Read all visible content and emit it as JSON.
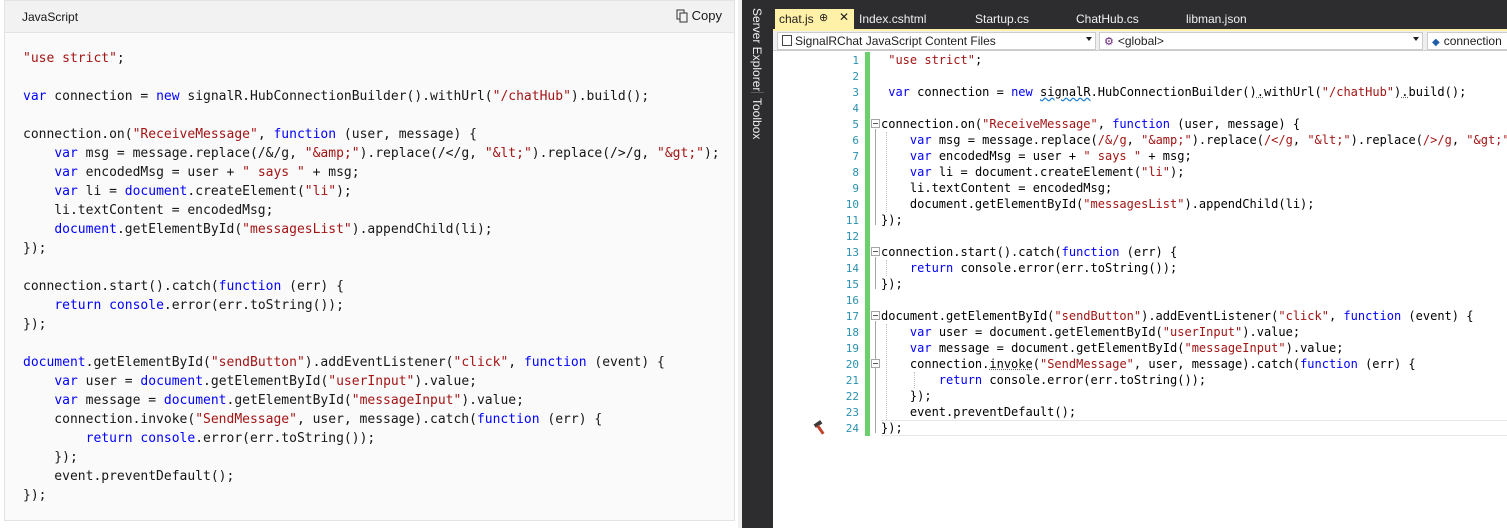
{
  "doc": {
    "language": "JavaScript",
    "copy_label": "Copy",
    "code_lines": [
      [
        {
          "t": "\"use strict\"",
          "c": "s"
        },
        {
          "t": ";"
        }
      ],
      [],
      [
        {
          "t": "var",
          "c": "k"
        },
        {
          "t": " connection = "
        },
        {
          "t": "new",
          "c": "k"
        },
        {
          "t": " signalR.HubConnectionBuilder().withUrl("
        },
        {
          "t": "\"/chatHub\"",
          "c": "s"
        },
        {
          "t": ").build();"
        }
      ],
      [],
      [
        {
          "t": "connection.on("
        },
        {
          "t": "\"ReceiveMessage\"",
          "c": "s"
        },
        {
          "t": ", "
        },
        {
          "t": "function",
          "c": "k"
        },
        {
          "t": " (user, message) {"
        }
      ],
      [
        {
          "t": "    "
        },
        {
          "t": "var",
          "c": "k"
        },
        {
          "t": " msg = message.replace(/&/g, "
        },
        {
          "t": "\"&amp;\"",
          "c": "s"
        },
        {
          "t": ").replace(/</g, "
        },
        {
          "t": "\"&lt;\"",
          "c": "s"
        },
        {
          "t": ").replace(/>/g, "
        },
        {
          "t": "\"&gt;\"",
          "c": "s"
        },
        {
          "t": ");"
        }
      ],
      [
        {
          "t": "    "
        },
        {
          "t": "var",
          "c": "k"
        },
        {
          "t": " encodedMsg = user + "
        },
        {
          "t": "\" says \"",
          "c": "s"
        },
        {
          "t": " + msg;"
        }
      ],
      [
        {
          "t": "    "
        },
        {
          "t": "var",
          "c": "k"
        },
        {
          "t": " li = "
        },
        {
          "t": "document",
          "c": "k"
        },
        {
          "t": ".createElement("
        },
        {
          "t": "\"li\"",
          "c": "s"
        },
        {
          "t": ");"
        }
      ],
      [
        {
          "t": "    li.textContent = encodedMsg;"
        }
      ],
      [
        {
          "t": "    "
        },
        {
          "t": "document",
          "c": "k"
        },
        {
          "t": ".getElementById("
        },
        {
          "t": "\"messagesList\"",
          "c": "s"
        },
        {
          "t": ").appendChild(li);"
        }
      ],
      [
        {
          "t": "});"
        }
      ],
      [],
      [
        {
          "t": "connection.start().catch("
        },
        {
          "t": "function",
          "c": "k"
        },
        {
          "t": " (err) {"
        }
      ],
      [
        {
          "t": "    "
        },
        {
          "t": "return",
          "c": "k"
        },
        {
          "t": " "
        },
        {
          "t": "console",
          "c": "k"
        },
        {
          "t": ".error(err.toString());"
        }
      ],
      [
        {
          "t": "});"
        }
      ],
      [],
      [
        {
          "t": "document",
          "c": "k"
        },
        {
          "t": ".getElementById("
        },
        {
          "t": "\"sendButton\"",
          "c": "s"
        },
        {
          "t": ").addEventListener("
        },
        {
          "t": "\"click\"",
          "c": "s"
        },
        {
          "t": ", "
        },
        {
          "t": "function",
          "c": "k"
        },
        {
          "t": " (event) {"
        }
      ],
      [
        {
          "t": "    "
        },
        {
          "t": "var",
          "c": "k"
        },
        {
          "t": " user = "
        },
        {
          "t": "document",
          "c": "k"
        },
        {
          "t": ".getElementById("
        },
        {
          "t": "\"userInput\"",
          "c": "s"
        },
        {
          "t": ").value;"
        }
      ],
      [
        {
          "t": "    "
        },
        {
          "t": "var",
          "c": "k"
        },
        {
          "t": " message = "
        },
        {
          "t": "document",
          "c": "k"
        },
        {
          "t": ".getElementById("
        },
        {
          "t": "\"messageInput\"",
          "c": "s"
        },
        {
          "t": ").value;"
        }
      ],
      [
        {
          "t": "    connection.invoke("
        },
        {
          "t": "\"SendMessage\"",
          "c": "s"
        },
        {
          "t": ", user, message).catch("
        },
        {
          "t": "function",
          "c": "k"
        },
        {
          "t": " (err) {"
        }
      ],
      [
        {
          "t": "        "
        },
        {
          "t": "return",
          "c": "k"
        },
        {
          "t": " "
        },
        {
          "t": "console",
          "c": "k"
        },
        {
          "t": ".error(err.toString());"
        }
      ],
      [
        {
          "t": "    });"
        }
      ],
      [
        {
          "t": "    event.preventDefault();"
        }
      ],
      [
        {
          "t": "});"
        }
      ]
    ]
  },
  "vs": {
    "side_tabs": [
      "Server Explorer",
      "Toolbox"
    ],
    "tabs": [
      "chat.js",
      "Index.cshtml",
      "Startup.cs",
      "ChatHub.cs",
      "libman.json"
    ],
    "active_tab_pin": "⊕",
    "active_tab_close": "✕",
    "nav": {
      "project": "SignalRChat JavaScript Content Files",
      "scope": "<global>",
      "member": "connection"
    },
    "line_numbers": [
      "1",
      "2",
      "3",
      "4",
      "5",
      "6",
      "7",
      "8",
      "9",
      "10",
      "11",
      "12",
      "13",
      "14",
      "15",
      "16",
      "17",
      "18",
      "19",
      "20",
      "21",
      "22",
      "23",
      "24"
    ],
    "code_lines": [
      [
        {
          "t": " "
        },
        {
          "t": "\"use strict\"",
          "c": "s"
        },
        {
          "t": ";"
        }
      ],
      [],
      [
        {
          "t": " "
        },
        {
          "t": "var",
          "c": "k"
        },
        {
          "t": " connection = "
        },
        {
          "t": "new",
          "c": "k"
        },
        {
          "t": " "
        },
        {
          "t": "signalR",
          "c": "q"
        },
        {
          "t": ".HubConnectionBuilder()"
        },
        {
          "t": ".",
          "c": "d"
        },
        {
          "t": "withUrl("
        },
        {
          "t": "\"/chatHub\"",
          "c": "s"
        },
        {
          "t": ")"
        },
        {
          "t": ".",
          "c": "d"
        },
        {
          "t": "build();"
        }
      ],
      [],
      [
        {
          "t": "connection.on("
        },
        {
          "t": "\"ReceiveMessage\"",
          "c": "s"
        },
        {
          "t": ", "
        },
        {
          "t": "function",
          "c": "k"
        },
        {
          "t": " (user, message) {"
        }
      ],
      [
        {
          "t": "    "
        },
        {
          "t": "var",
          "c": "k"
        },
        {
          "t": " msg = message.replace("
        },
        {
          "t": "/&/g",
          "c": "s"
        },
        {
          "t": ", "
        },
        {
          "t": "\"&amp;\"",
          "c": "s"
        },
        {
          "t": ").replace("
        },
        {
          "t": "/</g",
          "c": "s"
        },
        {
          "t": ", "
        },
        {
          "t": "\"&lt;\"",
          "c": "s"
        },
        {
          "t": ").replace("
        },
        {
          "t": "/>/g",
          "c": "s"
        },
        {
          "t": ", "
        },
        {
          "t": "\"&gt;\"",
          "c": "s"
        },
        {
          "t": ");"
        }
      ],
      [
        {
          "t": "    "
        },
        {
          "t": "var",
          "c": "k"
        },
        {
          "t": " encodedMsg = user + "
        },
        {
          "t": "\" says \"",
          "c": "s"
        },
        {
          "t": " + msg;"
        }
      ],
      [
        {
          "t": "    "
        },
        {
          "t": "var",
          "c": "k"
        },
        {
          "t": " li = document.createElement("
        },
        {
          "t": "\"li\"",
          "c": "s"
        },
        {
          "t": ");"
        }
      ],
      [
        {
          "t": "    li.textContent = encodedMsg;"
        }
      ],
      [
        {
          "t": "    document.getElementById("
        },
        {
          "t": "\"messagesList\"",
          "c": "s"
        },
        {
          "t": ").appendChild(li);"
        }
      ],
      [
        {
          "t": "});"
        }
      ],
      [],
      [
        {
          "t": "connection.start().catch("
        },
        {
          "t": "function",
          "c": "k"
        },
        {
          "t": " (err) {"
        }
      ],
      [
        {
          "t": "    "
        },
        {
          "t": "return",
          "c": "k"
        },
        {
          "t": " console.error(err.toString());"
        }
      ],
      [
        {
          "t": "});"
        }
      ],
      [],
      [
        {
          "t": "document.getElementById("
        },
        {
          "t": "\"sendButton\"",
          "c": "s"
        },
        {
          "t": ").addEventListener("
        },
        {
          "t": "\"click\"",
          "c": "s"
        },
        {
          "t": ", "
        },
        {
          "t": "function",
          "c": "k"
        },
        {
          "t": " (event) {"
        }
      ],
      [
        {
          "t": "    "
        },
        {
          "t": "var",
          "c": "k"
        },
        {
          "t": " user = document.getElementById("
        },
        {
          "t": "\"userInput\"",
          "c": "s"
        },
        {
          "t": ").value;"
        }
      ],
      [
        {
          "t": "    "
        },
        {
          "t": "var",
          "c": "k"
        },
        {
          "t": " message = document.getElementById("
        },
        {
          "t": "\"messageInput\"",
          "c": "s"
        },
        {
          "t": ").value;"
        }
      ],
      [
        {
          "t": "    connection."
        },
        {
          "t": "invoke",
          "c": "d"
        },
        {
          "t": "("
        },
        {
          "t": "\"SendMessage\"",
          "c": "s"
        },
        {
          "t": ", user, message).catch("
        },
        {
          "t": "function",
          "c": "k"
        },
        {
          "t": " (err) {"
        }
      ],
      [
        {
          "t": "        "
        },
        {
          "t": "return",
          "c": "k"
        },
        {
          "t": " console.error(err.toString());"
        }
      ],
      [
        {
          "t": "    });"
        }
      ],
      [
        {
          "t": "    event.preventDefault();"
        }
      ],
      [
        {
          "t": "});"
        }
      ]
    ]
  },
  "colors": {
    "keyword": "#0000ff",
    "string": "#a31515",
    "line_number": "#2b91af",
    "change_bar": "#6bd06b",
    "active_tab": "#fff1a8"
  }
}
